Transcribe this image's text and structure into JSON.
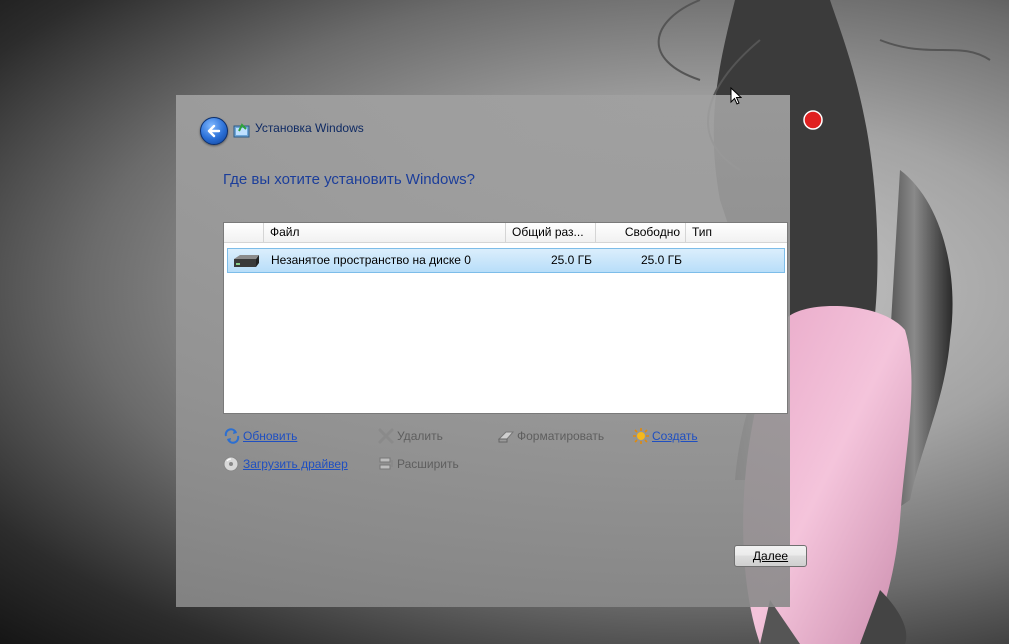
{
  "window": {
    "title": "Установка Windows"
  },
  "heading": "Где вы хотите установить Windows?",
  "table": {
    "columns": [
      "Файл",
      "Общий раз...",
      "Свободно",
      "Тип"
    ],
    "rows": [
      {
        "name": "Незанятое пространство на диске 0",
        "total": "25.0 ГБ",
        "free": "25.0 ГБ",
        "type": ""
      }
    ]
  },
  "actions": {
    "refresh": "Обновить",
    "delete": "Удалить",
    "format": "Форматировать",
    "new": "Создать",
    "load_driver": "Загрузить драйвер",
    "extend": "Расширить"
  },
  "buttons": {
    "next": "Далее"
  },
  "colors": {
    "heading": "#1c3e9a",
    "link": "#1f4fc1",
    "selected_row": "#b8def9"
  }
}
